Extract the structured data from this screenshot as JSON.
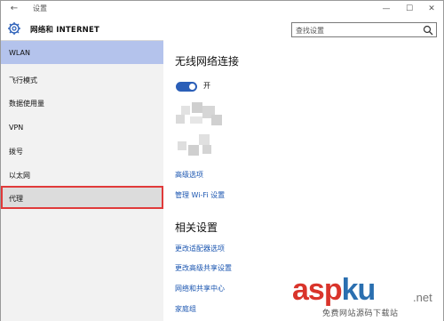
{
  "titlebar": {
    "title": "设置",
    "back_glyph": "←",
    "minimize_glyph": "—",
    "maximize_glyph": "☐",
    "close_glyph": "✕"
  },
  "header": {
    "title": "网络和 INTERNET",
    "icon": "gear-icon"
  },
  "search": {
    "placeholder": "查找设置",
    "icon": "search-icon"
  },
  "sidebar": {
    "items": [
      {
        "label": "WLAN",
        "state": "selected"
      },
      {
        "label": "飞行模式",
        "state": "normal"
      },
      {
        "label": "数据使用量",
        "state": "normal"
      },
      {
        "label": "VPN",
        "state": "normal"
      },
      {
        "label": "拨号",
        "state": "normal"
      },
      {
        "label": "以太网",
        "state": "normal"
      },
      {
        "label": "代理",
        "state": "highlighted"
      }
    ]
  },
  "content": {
    "wireless_title": "无线网络连接",
    "toggle_state": "开",
    "toggle_on": true,
    "links_top": [
      "高级选项",
      "管理 Wi-Fi 设置"
    ],
    "related_title": "相关设置",
    "related_links": [
      "更改适配器选项",
      "更改高级共享设置",
      "网络和共享中心",
      "家庭组"
    ]
  },
  "colors": {
    "accent": "#2b5fb8",
    "selected_bg": "#b4c3ec",
    "highlight_border": "#e03a3a",
    "link": "#1a55b0"
  },
  "watermark": {
    "main_red": "asp",
    "main_blue": "ku",
    "suffix": ".net",
    "subtitle": "免费网站源码下载站"
  }
}
